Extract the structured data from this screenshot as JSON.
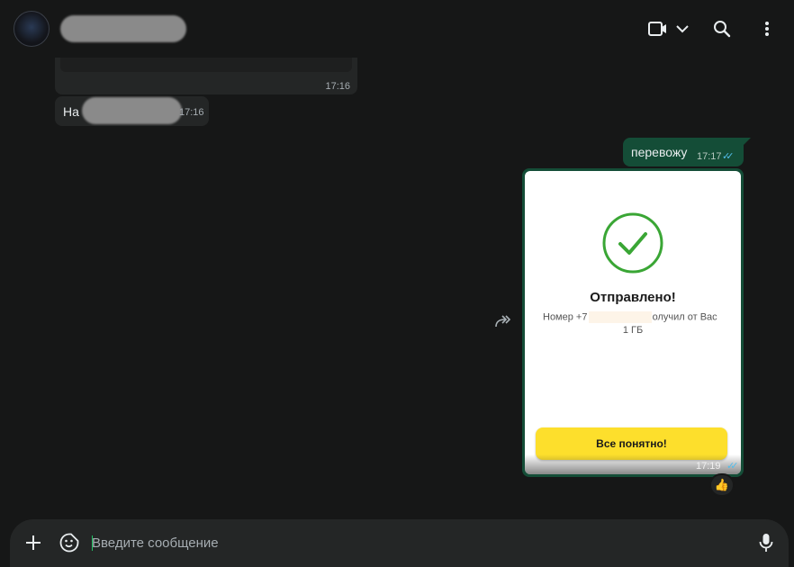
{
  "header": {
    "contact_name": "",
    "icons": [
      "video-call-icon",
      "chevron-down-icon",
      "search-icon",
      "menu-icon"
    ]
  },
  "messages": [
    {
      "direction": "incoming",
      "text": "",
      "time": "17:16"
    },
    {
      "direction": "incoming",
      "text": "На",
      "time": "17:16"
    },
    {
      "direction": "outgoing",
      "text": "перевожу",
      "time": "17:17",
      "status": "read"
    },
    {
      "direction": "outgoing",
      "type": "image",
      "time": "17:19",
      "status": "read",
      "image": {
        "title": "Отправлено!",
        "line1_prefix": "Номер +7",
        "line1_suffix": "олучил от Вас",
        "line2": "1 ГБ",
        "button_label": "Все понятно!"
      },
      "reaction": "👍"
    }
  ],
  "composer": {
    "placeholder": "Введите сообщение"
  },
  "colors": {
    "background": "#161717",
    "incoming_bubble": "#242626",
    "outgoing_bubble": "#144d37",
    "read_ticks": "#53bdeb",
    "success_green": "#3aa635",
    "button_yellow": "#fddf2c"
  }
}
